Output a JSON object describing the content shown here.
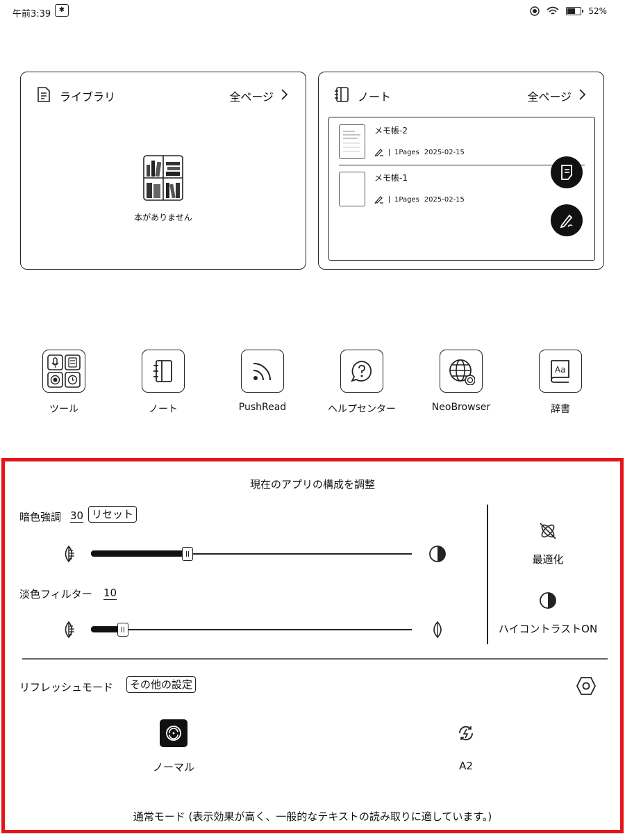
{
  "status_bar": {
    "time": "午前3:39",
    "battery": "52%"
  },
  "library": {
    "title": "ライブラリ",
    "all_pages": "全ページ",
    "empty": "本がありません"
  },
  "notes": {
    "title": "ノート",
    "all_pages": "全ページ",
    "items": [
      {
        "name": "メモ帳-2",
        "pages": "1Pages",
        "date": "2025-02-15"
      },
      {
        "name": "メモ帳-1",
        "pages": "1Pages",
        "date": "2025-02-15"
      }
    ]
  },
  "apps": [
    {
      "label": "ツール",
      "icon": "tools-grid-icon"
    },
    {
      "label": "ノート",
      "icon": "notebook-icon"
    },
    {
      "label": "PushRead",
      "icon": "rss-feed-icon"
    },
    {
      "label": "ヘルプセンター",
      "icon": "help-bubble-icon"
    },
    {
      "label": "NeoBrowser",
      "icon": "globe-icon"
    },
    {
      "label": "辞書",
      "icon": "dictionary-icon"
    }
  ],
  "settings": {
    "title": "現在のアプリの構成を調整",
    "dark_enhance": {
      "label": "暗色強調",
      "value": "30",
      "reset": "リセット",
      "level": 0.3
    },
    "light_filter": {
      "label": "淡色フィルター",
      "value": "10",
      "level": 0.1
    },
    "optimize_label": "最適化",
    "high_contrast_label": "ハイコントラストON",
    "refresh": {
      "label": "リフレッシュモード",
      "more": "その他の設定"
    },
    "modes": [
      {
        "label": "ノーマル",
        "selected": true
      },
      {
        "label": "A2",
        "selected": false
      }
    ],
    "description": "通常モード (表示効果が高く、一般的なテキストの読み取りに適しています。)"
  },
  "colors": {
    "accent_frame": "#e5141a",
    "ink": "#111111"
  }
}
